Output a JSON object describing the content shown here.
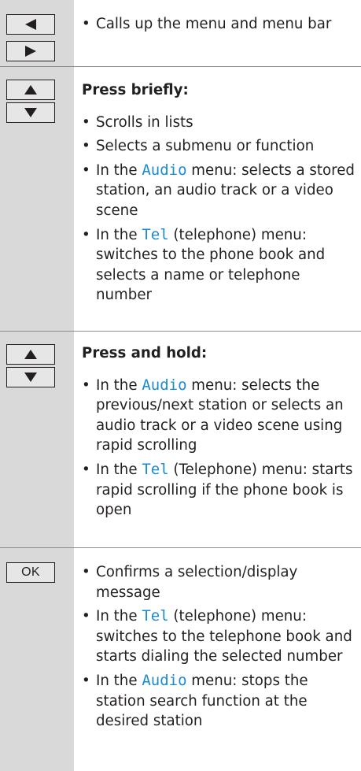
{
  "rows": [
    {
      "keys": [
        "left-arrow",
        "right-arrow"
      ],
      "items": [
        [
          "Calls up the menu and menu bar"
        ]
      ]
    },
    {
      "keys": [
        "up-arrow",
        "down-arrow"
      ],
      "heading": "Press briefly:",
      "items": [
        [
          "Scrolls in lists"
        ],
        [
          "Selects a submenu or function"
        ],
        [
          "In the ",
          "Audio",
          " menu: selects a stored station, an audio track or a video scene"
        ],
        [
          "In the ",
          "Tel",
          " (telephone) menu: switches to the phone book and selects a name or telephone number"
        ]
      ]
    },
    {
      "keys": [
        "up-arrow",
        "down-arrow"
      ],
      "heading": "Press and hold:",
      "items": [
        [
          "In the ",
          "Audio",
          " menu: selects the previous/next station or selects an audio track or a video scene using rapid scrolling"
        ],
        [
          "In the ",
          "Tel",
          " (Telephone) menu: starts rapid scrolling if the phone book is open"
        ]
      ]
    },
    {
      "keys": [
        "ok"
      ],
      "ok_label": "OK",
      "items": [
        [
          "Confirms a selection/display message"
        ],
        [
          "In the ",
          "Tel",
          " (telephone) menu: switches to the telephone book and starts dialing the selected number"
        ],
        [
          "In the ",
          "Audio",
          " menu: stops the station search function at the desired station"
        ]
      ]
    }
  ],
  "bullet": "•",
  "colors": {
    "keyword": "#1a8bd0",
    "left_column": "#d9d9d9",
    "divider": "#8c8c8c"
  }
}
